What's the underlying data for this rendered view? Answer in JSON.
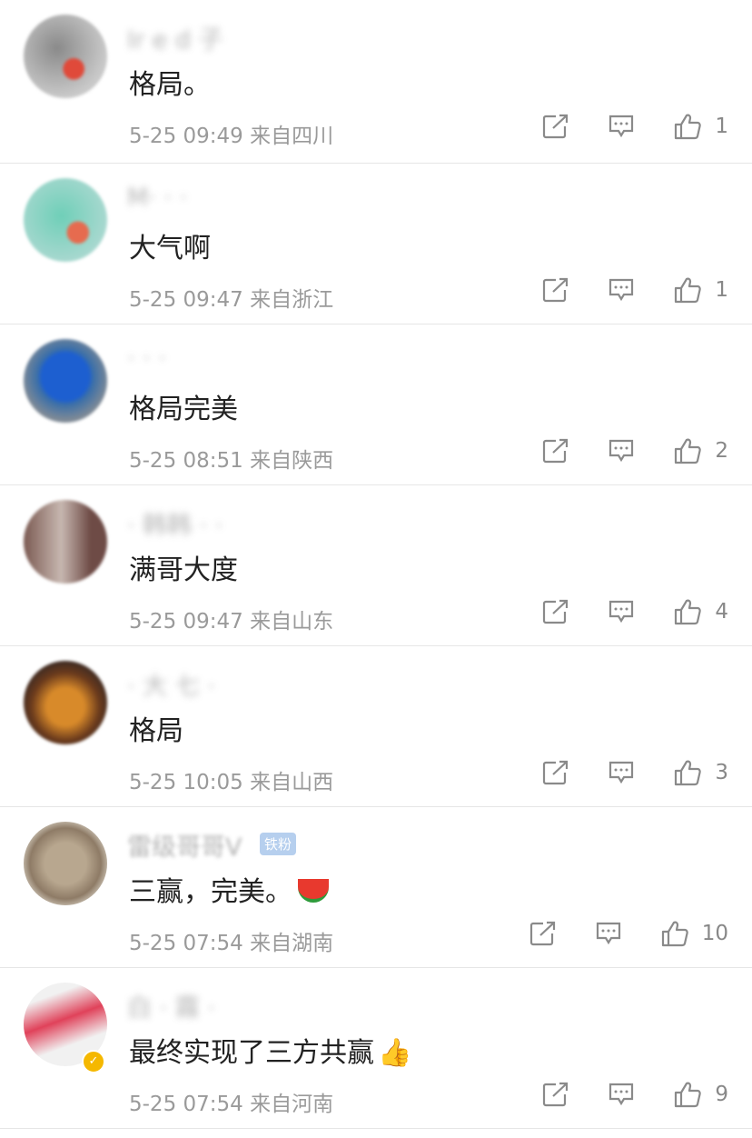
{
  "comments": [
    {
      "name": "Ir  e  d  子",
      "text": "格局。",
      "time": "5-25 09:49",
      "location": "来自四川",
      "likes": "1"
    },
    {
      "name": "M·  ·  ·",
      "text": "大气啊",
      "time": "5-25 09:47",
      "location": "来自浙江",
      "likes": "1"
    },
    {
      "name": "·  ·  ·",
      "text": "格局完美",
      "time": "5-25 08:51",
      "location": "来自陕西",
      "likes": "2"
    },
    {
      "name": "· 韩韩 · ·",
      "text": "满哥大度",
      "time": "5-25 09:47",
      "location": "来自山东",
      "likes": "4"
    },
    {
      "name": "· 大 七 ·",
      "text": "格局",
      "time": "5-25 10:05",
      "location": "来自山西",
      "likes": "3"
    },
    {
      "name": "雷级哥哥V",
      "badge": "铁粉",
      "text": "三赢，完美。",
      "emoji": "watermelon-emoji",
      "time": "5-25 07:54",
      "location": "来自湖南",
      "likes": "10"
    },
    {
      "name": "白 · 霧 ·",
      "text": "最终实现了三方共赢",
      "emoji": "thumbs-up-emoji",
      "time": "5-25 07:54",
      "location": "来自河南",
      "likes": "9"
    }
  ],
  "icons": {
    "share": "share-icon",
    "reply": "reply-icon",
    "like": "like-icon"
  },
  "colors": {
    "text": "#222222",
    "meta": "#9a9a9a",
    "divider": "#e6e6e6"
  }
}
